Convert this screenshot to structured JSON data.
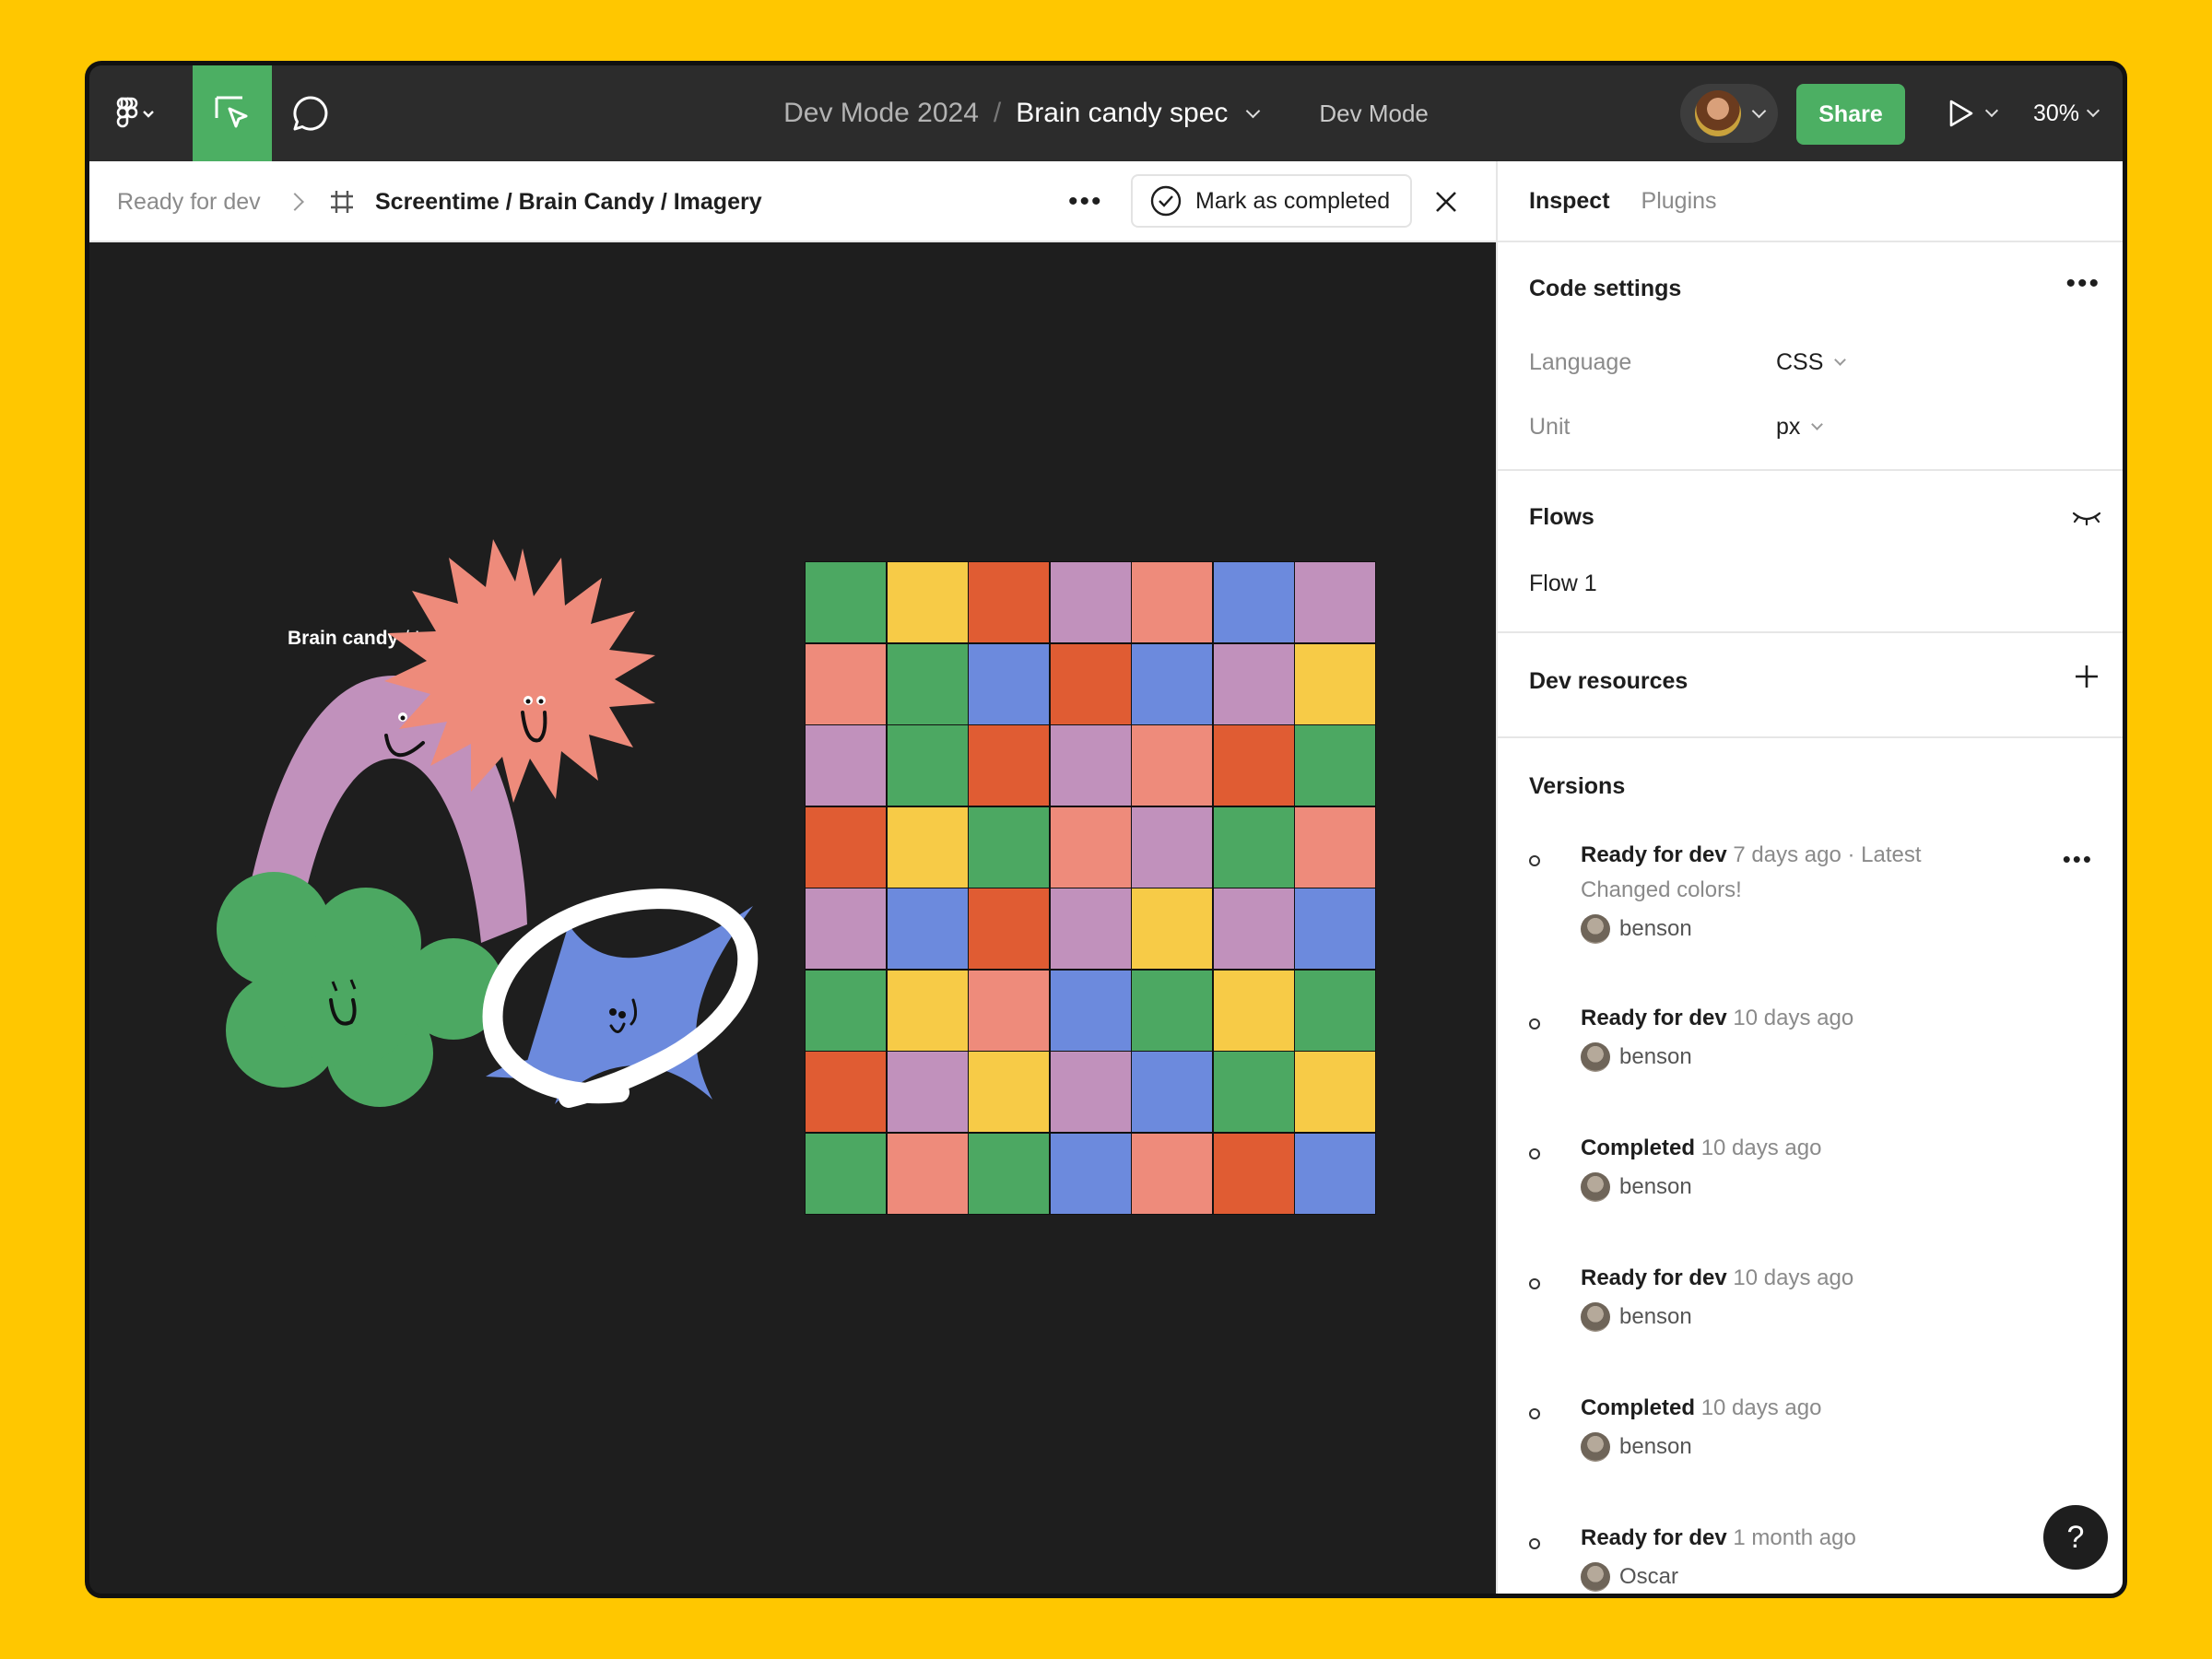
{
  "topbar": {
    "project": "Dev Mode 2024",
    "separator": "/",
    "file_name": "Brain candy spec",
    "mode_label": "Dev Mode",
    "share_label": "Share",
    "zoom": "30%",
    "icons": [
      "figma-logo-icon",
      "move-tool-icon",
      "comment-icon",
      "present-icon",
      "chevron-down-icon"
    ],
    "accent_color": "#4CAF63"
  },
  "breadcrumb": {
    "status": "Ready for dev",
    "path": "Screentime / Brain Candy / Imagery",
    "more_label": "•••",
    "mark_completed_label": "Mark as completed"
  },
  "canvas": {
    "frame_label_bold": "Brain candy",
    "frame_label_rest": " / Images",
    "palette": {
      "green": "#4CA862",
      "yellow": "#F7CB47",
      "orange": "#E05C33",
      "purple": "#C191BC",
      "salmon": "#EE8B7B",
      "blue": "#6C8ADD"
    },
    "grid_rows": [
      [
        "green",
        "yellow",
        "orange",
        "purple",
        "salmon",
        "blue",
        "purple"
      ],
      [
        "salmon",
        "green",
        "blue",
        "orange",
        "blue",
        "purple",
        "yellow"
      ],
      [
        "purple",
        "green",
        "orange",
        "purple",
        "salmon",
        "orange",
        "green"
      ],
      [
        "orange",
        "yellow",
        "green",
        "salmon",
        "purple",
        "green",
        "salmon"
      ],
      [
        "purple",
        "blue",
        "orange",
        "purple",
        "yellow",
        "purple",
        "blue"
      ],
      [
        "green",
        "yellow",
        "salmon",
        "blue",
        "green",
        "yellow",
        "green"
      ],
      [
        "orange",
        "purple",
        "yellow",
        "purple",
        "blue",
        "green",
        "yellow"
      ],
      [
        "green",
        "salmon",
        "green",
        "blue",
        "salmon",
        "orange",
        "blue"
      ]
    ]
  },
  "sidebar": {
    "tabs": [
      "Inspect",
      "Plugins"
    ],
    "code_settings": {
      "title": "Code settings",
      "more_label": "•••",
      "language_key": "Language",
      "language_val": "CSS",
      "unit_key": "Unit",
      "unit_val": "px"
    },
    "flows": {
      "title": "Flows",
      "item": "Flow 1"
    },
    "dev_resources": {
      "title": "Dev resources",
      "add_label": "+"
    },
    "versions": {
      "title": "Versions",
      "more_label": "•••",
      "items": [
        {
          "status": "Ready for dev",
          "time": "7 days ago · Latest",
          "message": "Changed colors!",
          "user": "benson"
        },
        {
          "status": "Ready for dev",
          "time": "10 days ago",
          "message": "",
          "user": "benson"
        },
        {
          "status": "Completed",
          "time": "10 days ago",
          "message": "",
          "user": "benson"
        },
        {
          "status": "Ready for dev",
          "time": "10 days ago",
          "message": "",
          "user": "benson"
        },
        {
          "status": "Completed",
          "time": "10 days ago",
          "message": "",
          "user": "benson"
        },
        {
          "status": "Ready for dev",
          "time": "1 month ago",
          "message": "",
          "user": "Oscar"
        }
      ]
    },
    "help_label": "?"
  }
}
